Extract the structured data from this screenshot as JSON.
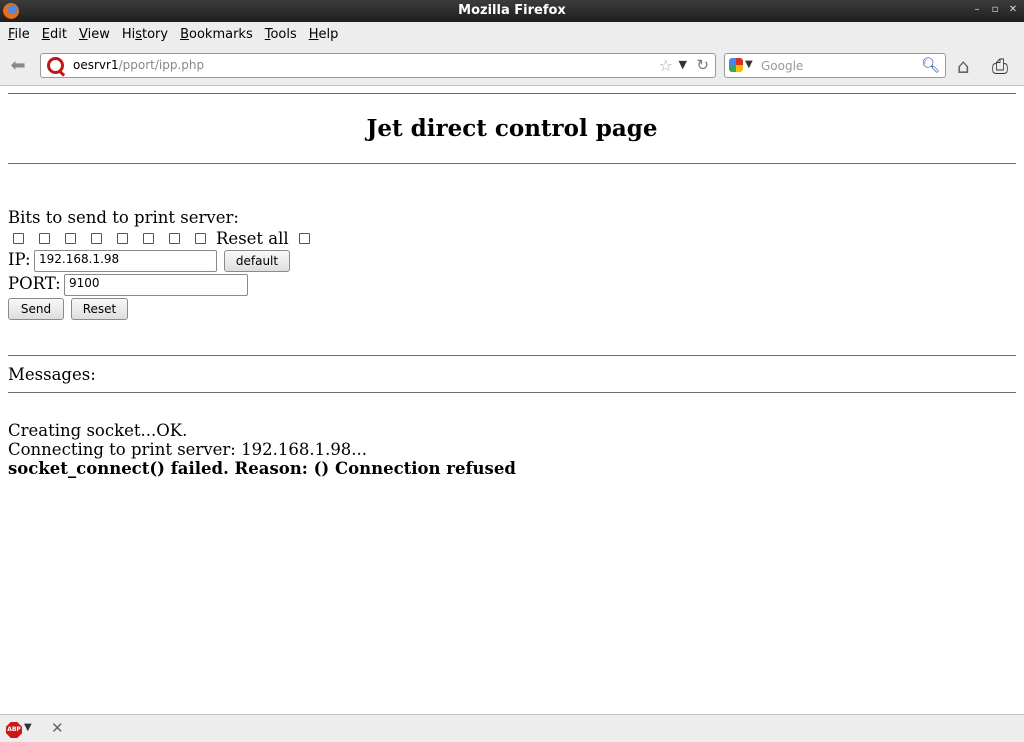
{
  "window": {
    "title": "Mozilla Firefox"
  },
  "menu": {
    "items": [
      {
        "key": "F",
        "rest": "ile"
      },
      {
        "key": "E",
        "rest": "dit"
      },
      {
        "key": "V",
        "rest": "iew"
      },
      {
        "pre": "Hi",
        "key": "s",
        "rest": "tory"
      },
      {
        "key": "B",
        "rest": "ookmarks"
      },
      {
        "key": "T",
        "rest": "ools"
      },
      {
        "key": "H",
        "rest": "elp"
      }
    ]
  },
  "urlbar": {
    "host": "oesrvr1",
    "path": "/pport/ipp.php"
  },
  "search": {
    "placeholder": "Google",
    "value": ""
  },
  "page": {
    "title": "Jet direct control page",
    "bits_label": "Bits to send to print server:",
    "reset_all_label": "Reset all",
    "ip_label": "IP:",
    "ip_value": "192.168.1.98",
    "default_button": "default",
    "port_label": "PORT:",
    "port_value": "9100",
    "send_button": "Send",
    "reset_button": "Reset",
    "messages_label": "Messages:",
    "messages": [
      "Creating socket...OK.",
      "Connecting to print server: 192.168.1.98...",
      "socket_connect() failed. Reason: () Connection refused"
    ]
  },
  "statusbar": {
    "abp_label": "ABP"
  }
}
